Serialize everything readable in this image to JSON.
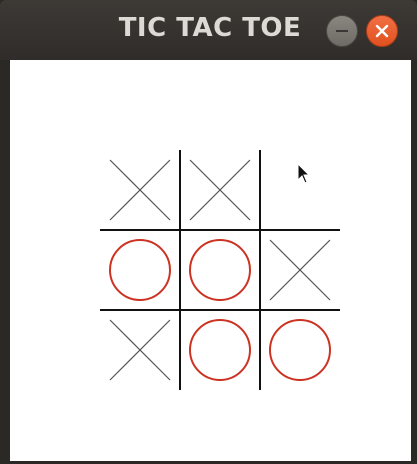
{
  "window": {
    "title": "TIC TAC TOE",
    "buttons": [
      "minimize",
      "close"
    ]
  },
  "board": {
    "cells": [
      [
        "X",
        "X",
        ""
      ],
      [
        "O",
        "O",
        "X"
      ],
      [
        "X",
        "O",
        "O"
      ]
    ]
  },
  "colors": {
    "x_mark": "#555555",
    "o_mark": "#cc3322",
    "grid_line": "#111111",
    "close_button": "#e95420",
    "titlebar": "#34312d"
  },
  "icons": {
    "minimize": "minimize-icon",
    "close": "close-icon",
    "cursor": "pointer-cursor-icon"
  }
}
